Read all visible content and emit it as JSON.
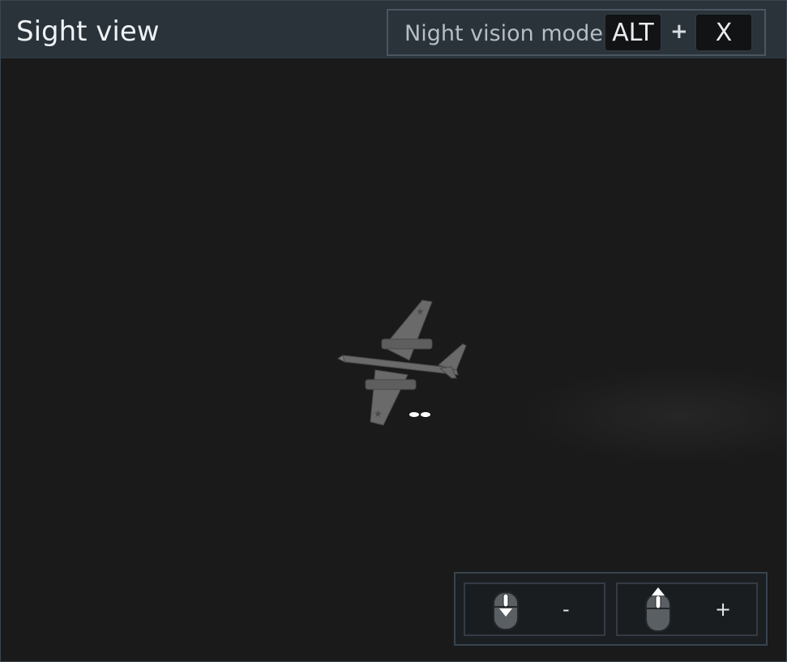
{
  "window": {
    "title": "Sight view"
  },
  "hint": {
    "label": "Night vision mode",
    "key1": "ALT",
    "plus": "+",
    "key2": "X"
  },
  "viewport": {
    "content": "aircraft-in-thermal-sight"
  },
  "zoom": {
    "out_icon": "mouse-scroll-down-icon",
    "out_label": "-",
    "in_icon": "mouse-scroll-up-icon",
    "in_label": "+"
  },
  "colors": {
    "titlebar": "#2a323a",
    "viewport": "#1a1a1a",
    "border": "#3a4650",
    "text": "#eef2f4"
  }
}
